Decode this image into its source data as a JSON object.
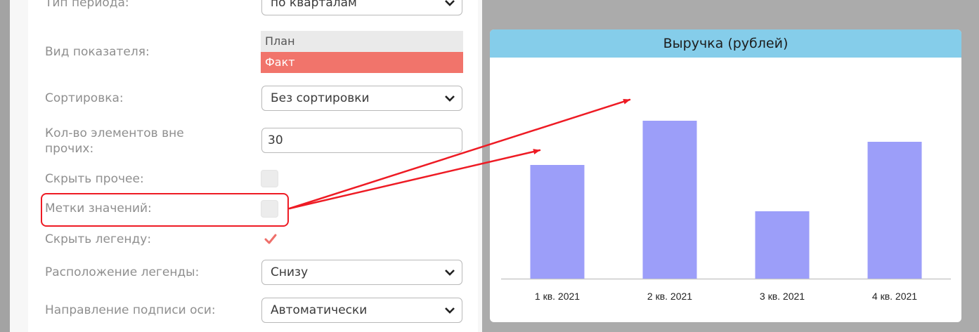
{
  "settings": {
    "period_type": {
      "label": "Тип периода:",
      "value": "по кварталам"
    },
    "indicator_type": {
      "label": "Вид показателя:",
      "options": [
        "План",
        "Факт"
      ],
      "selected": "Факт"
    },
    "sorting": {
      "label": "Сортировка:",
      "value": "Без сортировки"
    },
    "elements_count": {
      "label_line1": "Кол-во элементов вне",
      "label_line2": "прочих:",
      "value": "30"
    },
    "hide_other": {
      "label": "Скрыть прочее:",
      "checked": false
    },
    "value_labels": {
      "label": "Метки значений:",
      "checked": false
    },
    "hide_legend": {
      "label": "Скрыть легенду:",
      "checked": true
    },
    "legend_position": {
      "label": "Расположение легенды:",
      "value": "Снизу"
    },
    "axis_label_direction": {
      "label": "Направление подписи оси:",
      "value": "Автоматически"
    }
  },
  "colors": {
    "selected_option": "#f1746b",
    "chart_header": "#85cdea",
    "bar": "#9c9ef9",
    "annotation": "#ee1b24"
  },
  "chart_data": {
    "type": "bar",
    "title": "Выручка (рублей)",
    "categories": [
      "1 кв. 2021",
      "2 кв. 2021",
      "3 кв. 2021",
      "4 кв. 2021"
    ],
    "values": [
      54,
      75,
      32,
      65
    ],
    "ylim": [
      0,
      100
    ],
    "grid": false,
    "legend": "hidden"
  }
}
